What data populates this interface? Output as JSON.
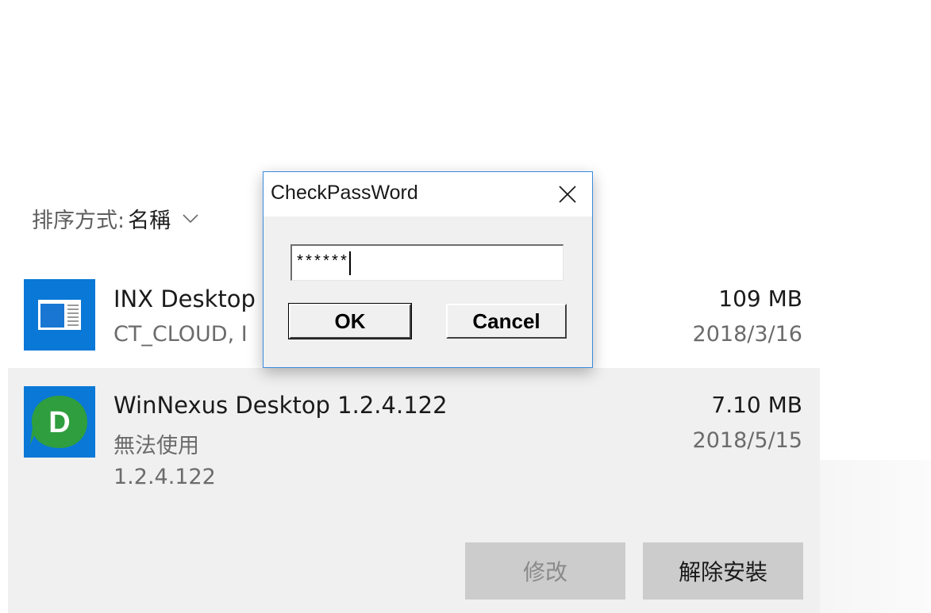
{
  "sort_bar": {
    "label": "排序方式:",
    "value": "名稱"
  },
  "apps": [
    {
      "name": "INX Desktop",
      "publisher": "CT_CLOUD, I",
      "size": "109 MB",
      "date": "2018/3/16",
      "icon": "app-window-icon"
    },
    {
      "name": "WinNexus Desktop 1.2.4.122",
      "status": "無法使用",
      "version": "1.2.4.122",
      "size": "7.10 MB",
      "date": "2018/5/15",
      "icon": "winnexus-d-icon",
      "icon_letter": "D",
      "modify_label": "修改",
      "uninstall_label": "解除安裝"
    }
  ],
  "dialog": {
    "title": "CheckPassWord",
    "password_value": "******",
    "ok_label": "OK",
    "cancel_label": "Cancel"
  },
  "colors": {
    "accent_blue": "#0a78d7",
    "winnexus_green": "#2f9e3e",
    "selected_row_bg": "#f0f0f0",
    "dialog_border": "#3a8ae0"
  }
}
